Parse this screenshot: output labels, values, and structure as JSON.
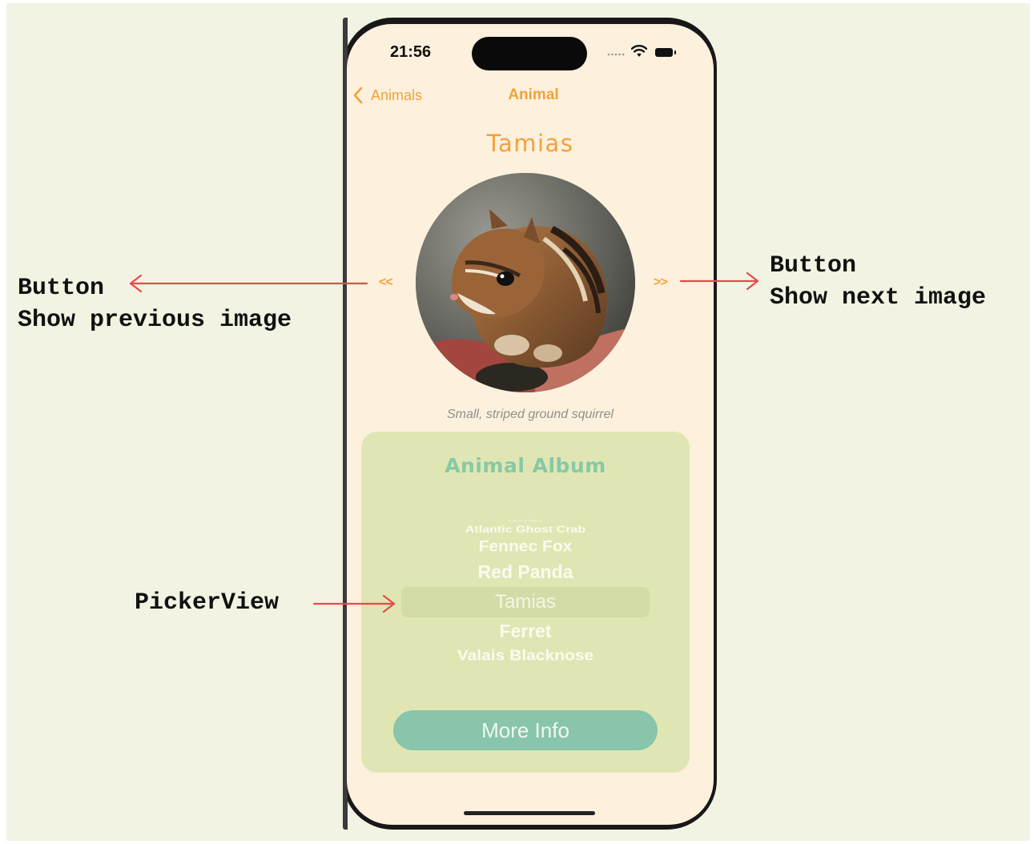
{
  "annotations": {
    "prev": {
      "line1": "Button",
      "line2": "Show previous image"
    },
    "next": {
      "line1": "Button",
      "line2": "Show next image"
    },
    "picker": {
      "label": "PickerView"
    },
    "arrow_color": "#e84a4a"
  },
  "status_bar": {
    "time": "21:56",
    "signal": "....."
  },
  "nav": {
    "back_label": "Animals",
    "title": "Animal"
  },
  "animal": {
    "name": "Tamias",
    "description": "Small, striped ground squirrel",
    "prev_label": "<<",
    "next_label": ">>",
    "photo_icon": "chipmunk-photo"
  },
  "album": {
    "title": "Animal Album",
    "picker_items": [
      {
        "label": "Clownfish",
        "selected": false
      },
      {
        "label": "Atlantic Ghost Crab",
        "selected": false
      },
      {
        "label": "Fennec Fox",
        "selected": false
      },
      {
        "label": "Red Panda",
        "selected": false
      },
      {
        "label": "Tamias",
        "selected": true
      },
      {
        "label": "Ferret",
        "selected": false
      },
      {
        "label": "Valais Blacknose",
        "selected": false
      }
    ],
    "button_label": "More Info"
  },
  "colors": {
    "accent": "#f0a43b",
    "album_bg": "#e0e6b3",
    "album_title": "#86c9a6",
    "button_bg": "#88c5ab",
    "screen_bg": "#fdf0dc",
    "page_bg": "#f3f3e3"
  }
}
